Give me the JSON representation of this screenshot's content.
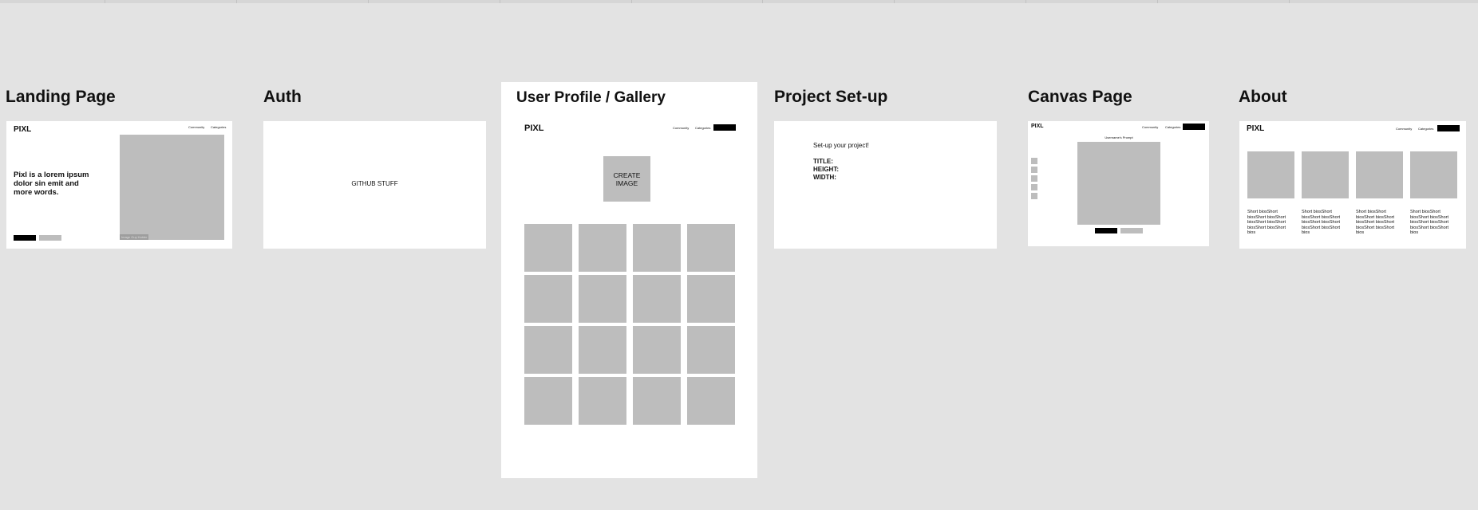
{
  "frames": {
    "landing": {
      "title": "Landing Page",
      "logo": "PIXL",
      "nav": [
        "Community",
        "Categories"
      ],
      "headline": "Pixl is a lorem ipsum dolor sin emit and more words.",
      "image_caption": "Image Guy Holder"
    },
    "auth": {
      "title": "Auth",
      "body_text": "GITHUB STUFF"
    },
    "profile": {
      "title": "User Profile / Gallery",
      "logo": "PIXL",
      "nav": [
        "Community",
        "Categories"
      ],
      "create_button": "CREATE IMAGE"
    },
    "project_setup": {
      "title": "Project Set-up",
      "heading": "Set-up your project!",
      "fields": [
        "TITLE:",
        "HEIGHT:",
        "WIDTH:"
      ]
    },
    "canvas": {
      "title": "Canvas Page",
      "logo": "PIXL",
      "nav": [
        "Community",
        "Categories"
      ],
      "canvas_label": "Username's Prompt"
    },
    "about": {
      "title": "About",
      "logo": "PIXL",
      "nav": [
        "Community",
        "Categories"
      ],
      "bios": [
        "Short biosShort biosShort biosShort biosShort biosShort biosShort biosShort bios",
        "Short biosShort biosShort biosShort biosShort biosShort biosShort biosShort bios",
        "Short biosShort biosShort biosShort biosShort biosShort biosShort biosShort bios",
        "Short biosShort biosShort biosShort biosShort biosShort biosShort biosShort bios"
      ]
    }
  }
}
